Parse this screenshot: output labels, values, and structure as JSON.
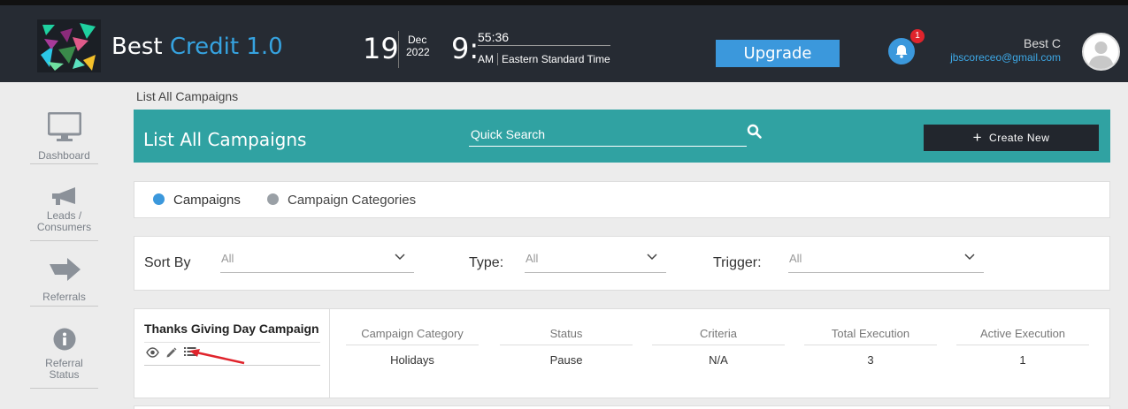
{
  "header": {
    "brand_prefix": "Best",
    "brand_accent": "Credit 1.0",
    "date_day": "19",
    "date_month": "Dec",
    "date_year": "2022",
    "time_hour": "9:",
    "time_minsec": "55:36",
    "time_ampm": "AM",
    "timezone": "Eastern Standard Time",
    "upgrade_label": "Upgrade",
    "notification_count": "1",
    "user_name": "Best C",
    "user_email": "jbscoreceo@gmail.com"
  },
  "sidebar": {
    "items": [
      {
        "label": "Dashboard",
        "icon": "monitor-icon"
      },
      {
        "label": "Leads / Consumers",
        "icon": "megaphone-icon"
      },
      {
        "label": "Referrals",
        "icon": "arrow-right-icon"
      },
      {
        "label": "Referral Status",
        "icon": "info-icon"
      }
    ]
  },
  "breadcrumb": "List All Campaigns",
  "banner": {
    "title": "List All Campaigns",
    "search_placeholder": "Quick Search",
    "create_label": "Create New"
  },
  "tabs": [
    {
      "label": "Campaigns",
      "active": true
    },
    {
      "label": "Campaign Categories",
      "active": false
    }
  ],
  "filters": {
    "sort_label": "Sort By",
    "sort_value": "All",
    "type_label": "Type:",
    "type_value": "All",
    "trigger_label": "Trigger:",
    "trigger_value": "All"
  },
  "campaigns": [
    {
      "name": "Thanks Giving Day Campaign",
      "columns": [
        "Campaign Category",
        "Status",
        "Criteria",
        "Total Execution",
        "Active Execution"
      ],
      "values": [
        "Holidays",
        "Pause",
        "N/A",
        "3",
        "1"
      ]
    }
  ],
  "colors": {
    "header_bg": "#262b33",
    "accent_blue": "#36a3e0",
    "banner_teal": "#30a2a2",
    "button_dark": "#22262d",
    "annotation_red": "#e0242c"
  }
}
